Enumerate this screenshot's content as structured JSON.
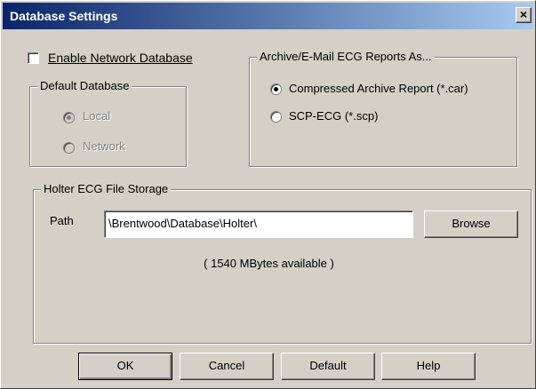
{
  "window": {
    "title": "Database Settings",
    "close_label": "×"
  },
  "network": {
    "enable_label": "Enable Network Database",
    "checked": false
  },
  "default_db": {
    "legend": "Default Database",
    "options": [
      {
        "label": "Local",
        "selected": true
      },
      {
        "label": "Network",
        "selected": false
      }
    ]
  },
  "archive": {
    "legend": "Archive/E-Mail ECG Reports As...",
    "options": [
      {
        "label": "Compressed Archive Report (*.car)",
        "selected": true
      },
      {
        "label": "SCP-ECG (*.scp)",
        "selected": false
      }
    ]
  },
  "holter": {
    "legend": "Holter ECG File Storage",
    "path_label": "Path",
    "path_value": "\\Brentwood\\Database\\Holter\\",
    "browse_label": "Browse",
    "available_text": "( 1540 MBytes available )"
  },
  "buttons": {
    "ok": "OK",
    "cancel": "Cancel",
    "default": "Default",
    "help": "Help"
  }
}
